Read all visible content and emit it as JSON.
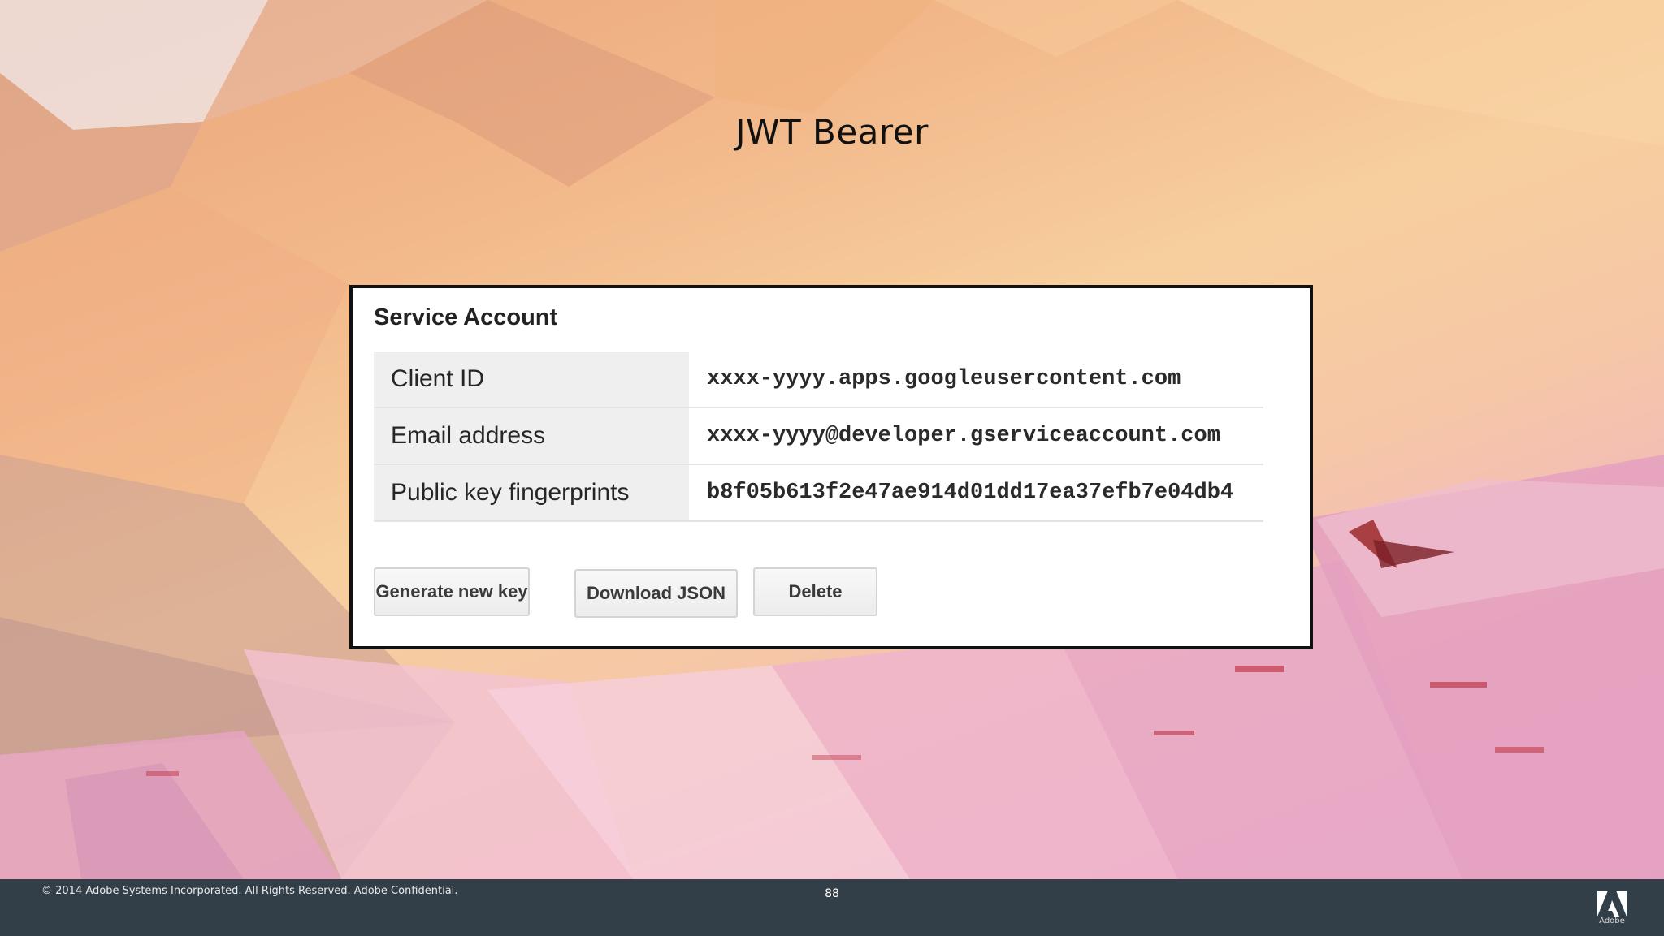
{
  "slide": {
    "title": "JWT Bearer",
    "page_number": "88",
    "copyright": "© 2014 Adobe Systems Incorporated.  All Rights Reserved.  Adobe Confidential.",
    "logo_text": "Adobe"
  },
  "service_account": {
    "heading": "Service Account",
    "rows": [
      {
        "label": "Client ID",
        "value": "xxxx-yyyy.apps.googleusercontent.com"
      },
      {
        "label": "Email address",
        "value": "xxxx-yyyy@developer.gserviceaccount.com"
      },
      {
        "label": "Public key fingerprints",
        "value": "b8f05b613f2e47ae914d01dd17ea37efb7e04db4"
      }
    ],
    "buttons": {
      "generate": "Generate new key",
      "download": "Download JSON",
      "delete": "Delete"
    }
  },
  "colors": {
    "footer_bg": "#333f48",
    "frame_border": "#111111",
    "label_bg": "#efefef"
  },
  "icons": {
    "logo": "adobe-logo-icon"
  }
}
